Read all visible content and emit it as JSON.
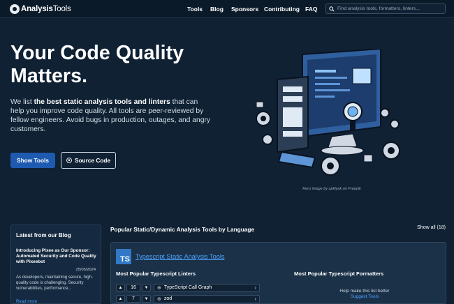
{
  "nav": {
    "logo": {
      "bold": "Analysis",
      "light": "Tools"
    },
    "links": [
      "Tools",
      "Blog",
      "Sponsors",
      "Contributing",
      "FAQ"
    ],
    "search_placeholder": "Find analysis tools, formatters, linters..."
  },
  "hero": {
    "title": "Your Code Quality Matters.",
    "desc_prefix": "We list ",
    "desc_bold": "the best static analysis tools and linters",
    "desc_suffix": " that can help you improve code quality. All tools are peer-reviewed by fellow engineers. Avoid bugs in production, outages, and angry customers.",
    "show_tools": "Show Tools",
    "source_code": "Source Code",
    "credit": "Hero image by upklyak on Freepik"
  },
  "blog": {
    "heading": "Latest from our Blog",
    "post_title": "Introducing Pixee as Our Sponsor: Automated Security and Code Quality with Pixeebot",
    "post_date": "25/05/2024",
    "post_excerpt": "As developers, maintaining secure, high-quality code is challenging. Security vulnerabilities, performance...",
    "read_more": "Read more"
  },
  "popular": {
    "heading": "Popular Static/Dynamic Analysis Tools by Language",
    "show_all": "Show all (18)",
    "language": {
      "badge": "TS",
      "link": "Typescript Static Analysis Tools",
      "linters_heading": "Most Popular Typescript Linters",
      "formatters_heading": "Most Popular Typescript Formatters",
      "linters": [
        {
          "votes": "16",
          "name": "TypeScript Call Graph"
        },
        {
          "votes": "7",
          "name": "zod"
        }
      ],
      "help_text": "Help make this list better",
      "suggest_link": "Suggest Tools"
    }
  },
  "colors": {
    "background": "#0f2133",
    "accent": "#1e5bb0",
    "link": "#4da3ff"
  }
}
